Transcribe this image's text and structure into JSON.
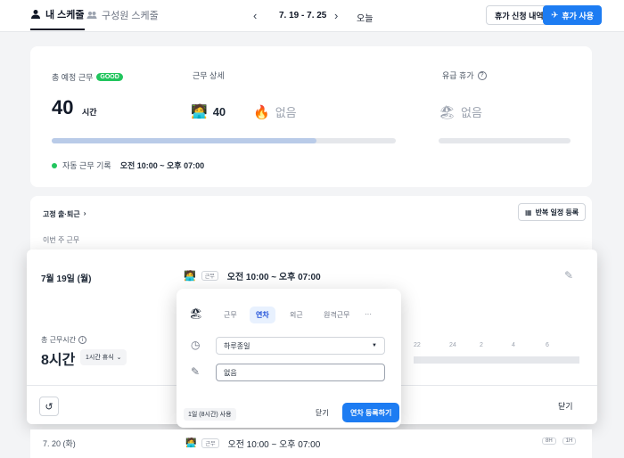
{
  "colors": {
    "primary": "#1d7cf2",
    "good": "#22c55e",
    "progress": "#b9cbe8"
  },
  "tabs": [
    {
      "label": "내 스케줄",
      "icon": "person-icon",
      "active": true
    },
    {
      "label": "구성원 스케줄",
      "icon": "people-icon",
      "active": false
    }
  ],
  "week": {
    "range": "7. 19 - 7. 25",
    "today": "오늘"
  },
  "actions": {
    "leave_history": "휴가 신청 내역",
    "use_leave": "휴가 사용"
  },
  "summary": {
    "scheduled_label": "총 예정 근무",
    "good_badge": "GOOD",
    "hours": "40",
    "hours_unit": "시간",
    "progress_fraction": 0.77,
    "detail_label": "근무 상세",
    "work_value": "40",
    "overtime_value": "없음",
    "paid_leave_label": "유급 휴가",
    "paid_leave_value": "없음",
    "auto_record_label": "자동 근무 기록",
    "auto_record_time": "오전 10:00 ~ 오후 07:00"
  },
  "fixed": {
    "title": "고정 출·퇴근",
    "repeat_btn": "반복 일정 등록",
    "this_week": "이번 주 근무"
  },
  "day": {
    "date": "7월 19일 (월)",
    "work_tag": "근무",
    "time": "오전 10:00 ~ 오후 07:00",
    "total_label": "총 근무시간",
    "total_value": "8시간",
    "break_label": "1시간 휴식",
    "timeline_labels": [
      "22",
      "24",
      "2",
      "4",
      "6"
    ],
    "close": "닫기"
  },
  "popover": {
    "tabs": [
      "근무",
      "연차",
      "외근",
      "원격근무",
      "···"
    ],
    "active_tab": "연차",
    "duration": "하루종일",
    "memo": "없음",
    "quota": "1일 (8시간) 사용",
    "close": "닫기",
    "submit": "연차 등록하기"
  },
  "next": {
    "date": "7. 20 (화)",
    "work_tag": "근무",
    "time": "오전 10:00 ~ 오후 07:00",
    "badge_hours": "8H",
    "badge_break": "1H"
  }
}
